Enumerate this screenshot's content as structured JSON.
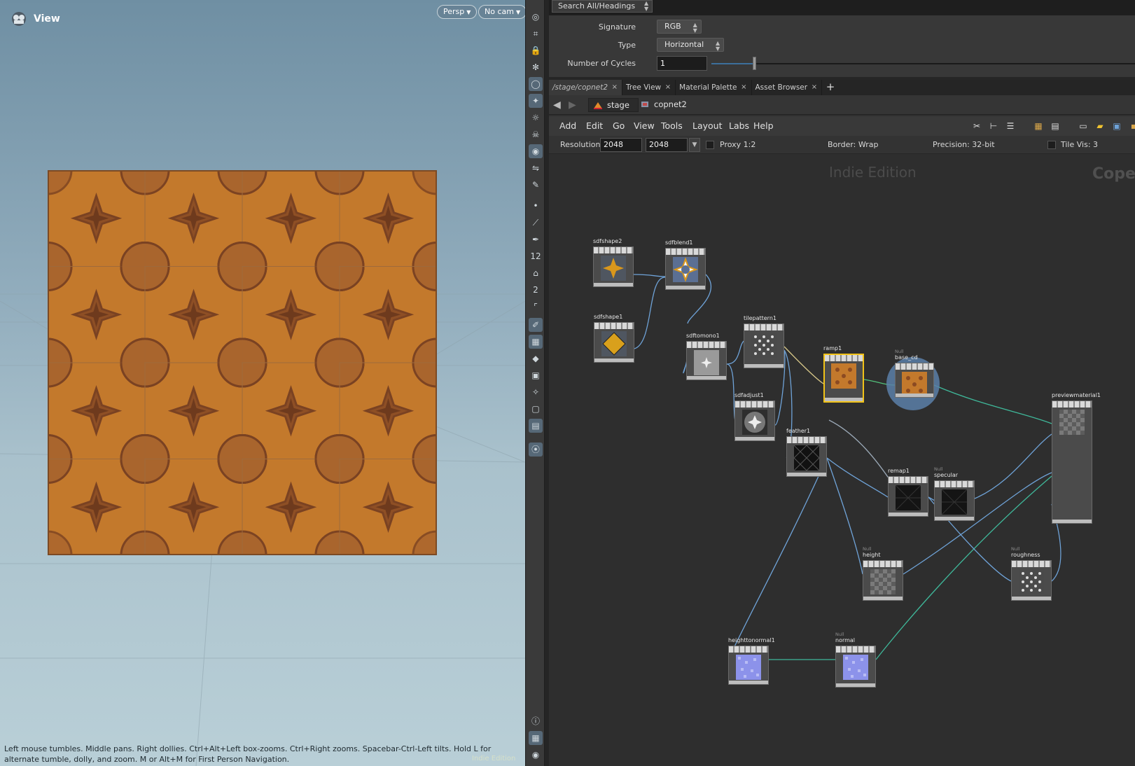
{
  "viewport": {
    "title": "View",
    "persp_label": "Persp",
    "cam_label": "No cam",
    "hint": "Left mouse tumbles. Middle pans. Right dollies. Ctrl+Alt+Left box-zooms. Ctrl+Right zooms. Spacebar-Ctrl-Left tilts. Hold L for alternate tumble, dolly, and zoom. M or Alt+M for First Person Navigation.",
    "watermark": "Indie Edition",
    "tile_color": "#c3792c",
    "tile_dark": "#7a4222"
  },
  "toolbar_icons": [
    "viewport-options-icon",
    "camera-icon",
    "lock-icon",
    "ghost-icon",
    "sphere-icon",
    "light-icon",
    "headlight-icon",
    "skull-icon",
    "render-icon",
    "flip-icon",
    "stage-icon",
    "point-icon",
    "edge-icon",
    "pen-icon",
    "number-12-icon",
    "paint-icon",
    "number-2-icon",
    "corner-icon",
    "brush-icon",
    "checker-icon",
    "diamond-icon",
    "map-icon",
    "handle-icon",
    "box-icon",
    "image-icon",
    "pin-icon",
    "info-icon",
    "grid-icon",
    "eye-icon"
  ],
  "params": {
    "search_label": "Search All/Headings",
    "signature_label": "Signature",
    "signature_value": "RGB",
    "type_label": "Type",
    "type_value": "Horizontal",
    "cycles_label": "Number of Cycles",
    "cycles_value": "1",
    "cycles_fraction": 0.1
  },
  "tabs": [
    {
      "label": "/stage/copnet2",
      "close": "×"
    },
    {
      "label": "Tree View",
      "close": "×"
    },
    {
      "label": "Material Palette",
      "close": "×"
    },
    {
      "label": "Asset Browser",
      "close": "×"
    }
  ],
  "tab_add": "+",
  "path": {
    "crumb1": "stage",
    "crumb2": "copnet2"
  },
  "menus": [
    "Add",
    "Edit",
    "Go",
    "View",
    "Tools",
    "Layout",
    "Labs",
    "Help"
  ],
  "resbar": {
    "resolution_label": "Resolution",
    "res_x": "2048",
    "res_y": "2048",
    "proxy_label": "Proxy 1:2",
    "border_label": "Border: Wrap",
    "precision_label": "Precision: 32-bit",
    "tilevis_label": "Tile Vis: 3"
  },
  "network": {
    "edition": "Indie Edition",
    "context_word": "Coper",
    "null_tag": "Null",
    "nodes": [
      {
        "id": "sdfshape2",
        "label": "sdfshape2",
        "thumb": "star-gold",
        "null": false
      },
      {
        "id": "sdfblend1",
        "label": "sdfblend1",
        "thumb": "star-outline",
        "null": false
      },
      {
        "id": "sdfshape1",
        "label": "sdfshape1",
        "thumb": "diamond-gold",
        "null": false
      },
      {
        "id": "sdftomono1",
        "label": "sdftomono1",
        "thumb": "mono-star",
        "null": false
      },
      {
        "id": "tilepattern1",
        "label": "tilepattern1",
        "thumb": "pattern-light",
        "null": false
      },
      {
        "id": "sdfadjust1",
        "label": "sdfadjust1",
        "thumb": "adjust-star",
        "null": false
      },
      {
        "id": "feather1",
        "label": "feather1",
        "thumb": "pattern-dark",
        "null": false
      },
      {
        "id": "ramp1",
        "label": "ramp1",
        "thumb": "orange",
        "null": false,
        "selected": true
      },
      {
        "id": "base_cd",
        "label": "base_cd",
        "thumb": "orange",
        "null": true,
        "ring": true
      },
      {
        "id": "remap1",
        "label": "remap1",
        "thumb": "dark",
        "null": false
      },
      {
        "id": "specular",
        "label": "specular",
        "thumb": "dark",
        "null": true
      },
      {
        "id": "height",
        "label": "height",
        "thumb": "checker",
        "null": true
      },
      {
        "id": "roughness",
        "label": "roughness",
        "thumb": "pattern-light",
        "null": true
      },
      {
        "id": "previewmaterial1",
        "label": "previewmaterial1",
        "thumb": "checker",
        "null": false
      },
      {
        "id": "heighttonormal1",
        "label": "heighttonormal1",
        "thumb": "normal",
        "null": false
      },
      {
        "id": "normal",
        "label": "normal",
        "thumb": "normal",
        "null": true
      }
    ]
  }
}
